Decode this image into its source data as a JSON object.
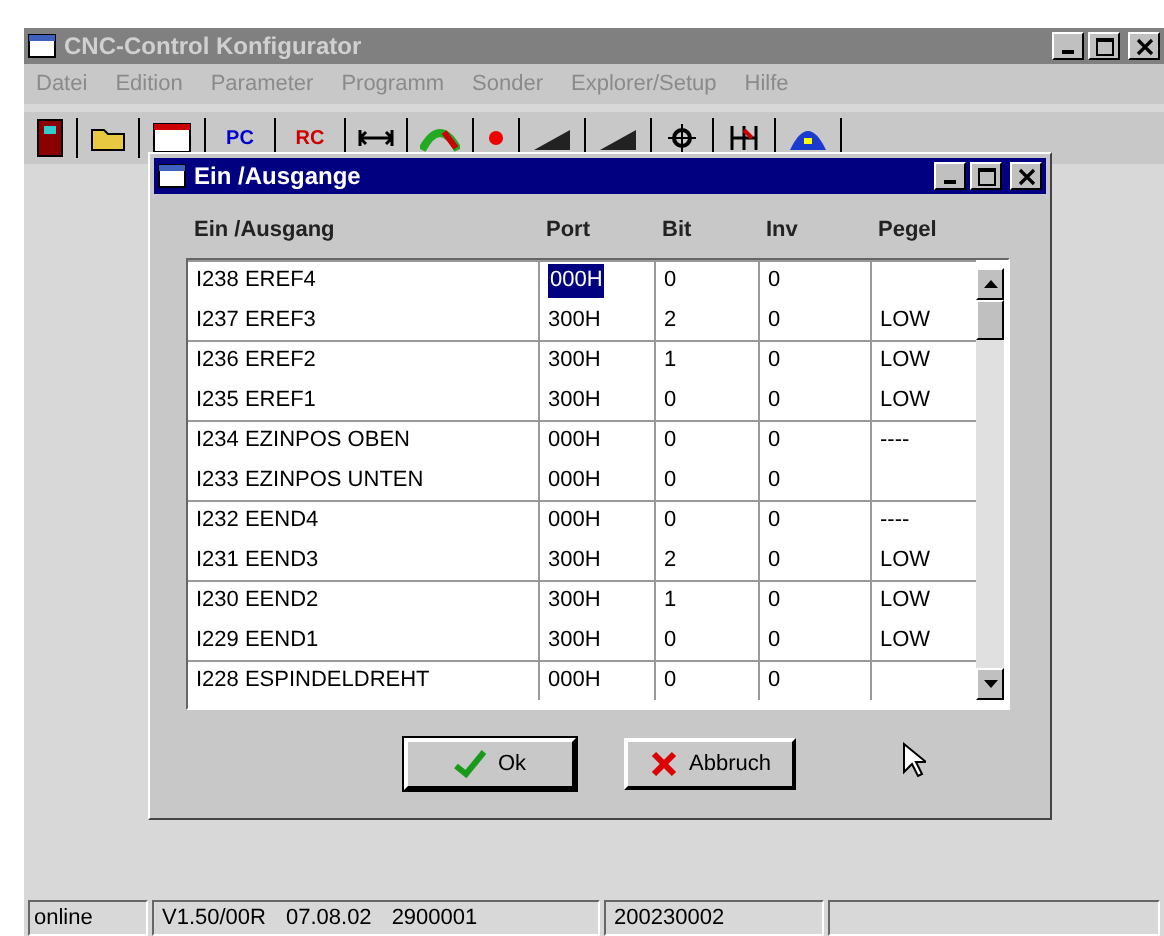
{
  "window": {
    "title": "CNC-Control Konfigurator"
  },
  "menu": [
    "Datei",
    "Edition",
    "Parameter",
    "Programm",
    "Sonder",
    "Explorer/Setup",
    "Hilfe"
  ],
  "toolbar": [
    {
      "kind": "door"
    },
    {
      "kind": "folder"
    },
    {
      "kind": "window"
    },
    {
      "kind": "text",
      "label": "PC",
      "color": "#0000cc"
    },
    {
      "kind": "text",
      "label": "RC",
      "color": "#cc0000"
    },
    {
      "kind": "arrows"
    },
    {
      "kind": "arch"
    },
    {
      "kind": "dot"
    },
    {
      "kind": "ramp"
    },
    {
      "kind": "ramp"
    },
    {
      "kind": "gear"
    },
    {
      "kind": "fork"
    },
    {
      "kind": "dome"
    }
  ],
  "dialog": {
    "title": "Ein /Ausgange",
    "columns": [
      "Ein /Ausgang",
      "Port",
      "Bit",
      "Inv",
      "Pegel"
    ],
    "rows": [
      {
        "name": "I238 EREF4",
        "port": "000H",
        "bit": "0",
        "inv": "0",
        "pegel": "",
        "selected": true
      },
      {
        "name": "I237 EREF3",
        "port": "300H",
        "bit": "2",
        "inv": "0",
        "pegel": "LOW",
        "selected": false
      },
      {
        "name": "I236 EREF2",
        "port": "300H",
        "bit": "1",
        "inv": "0",
        "pegel": "LOW",
        "selected": false
      },
      {
        "name": "I235 EREF1",
        "port": "300H",
        "bit": "0",
        "inv": "0",
        "pegel": "LOW",
        "selected": false
      },
      {
        "name": "I234 EZINPOS OBEN",
        "port": "000H",
        "bit": "0",
        "inv": "0",
        "pegel": "----",
        "selected": false
      },
      {
        "name": "I233 EZINPOS UNTEN",
        "port": "000H",
        "bit": "0",
        "inv": "0",
        "pegel": "",
        "selected": false
      },
      {
        "name": "I232 EEND4",
        "port": "000H",
        "bit": "0",
        "inv": "0",
        "pegel": "----",
        "selected": false
      },
      {
        "name": "I231 EEND3",
        "port": "300H",
        "bit": "2",
        "inv": "0",
        "pegel": "LOW",
        "selected": false
      },
      {
        "name": "I230 EEND2",
        "port": "300H",
        "bit": "1",
        "inv": "0",
        "pegel": "LOW",
        "selected": false
      },
      {
        "name": "I229 EEND1",
        "port": "300H",
        "bit": "0",
        "inv": "0",
        "pegel": "LOW",
        "selected": false
      },
      {
        "name": "I228 ESPINDELDREHT",
        "port": "000H",
        "bit": "0",
        "inv": "0",
        "pegel": "",
        "selected": false
      }
    ],
    "buttons": [
      {
        "kind": "ok",
        "label": "Ok"
      },
      {
        "kind": "cancel",
        "label": "Abbruch"
      }
    ]
  },
  "status_bar": [
    "online",
    "V1.50/00R",
    "07.08.02",
    "2900001",
    "200230002"
  ]
}
